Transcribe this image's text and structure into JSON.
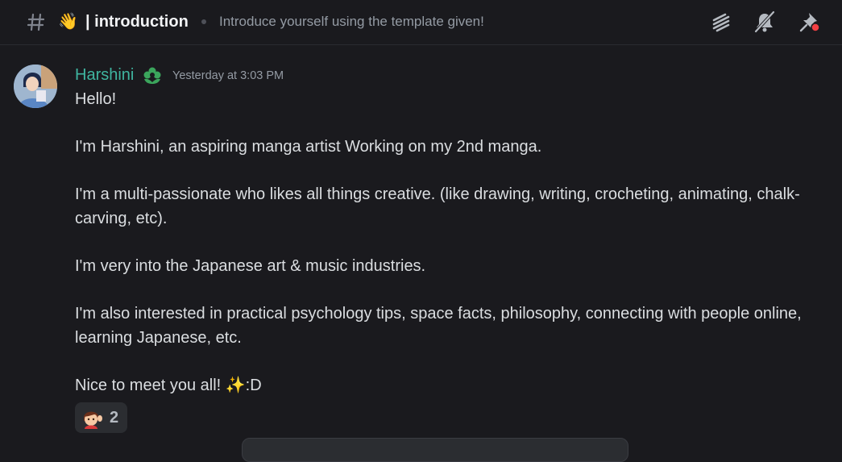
{
  "header": {
    "channel_emoji": "👋",
    "channel_name": "| introduction",
    "topic": "Introduce yourself using the template given!",
    "icons": [
      "threads-icon",
      "notification-muted-icon",
      "pin-icon"
    ]
  },
  "message": {
    "username": "Harshini",
    "username_color": "#3fb5a0",
    "role_icon": "flower-icon",
    "timestamp": "Yesterday at 3:03 PM",
    "lines": [
      "Hello!",
      "I'm Harshini, an aspiring manga artist Working on my 2nd manga.",
      "I'm a multi-passionate who likes all things creative. (like drawing, writing, crocheting, animating, chalk-carving, etc).",
      "I'm very into the Japanese art & music industries.",
      "I'm also interested in practical psychology tips, space facts, philosophy, connecting with people online, learning Japanese, etc.",
      "Nice to meet you all! ✨:D"
    ],
    "reaction": {
      "emoji": "waving-person-emoji",
      "count": "2"
    }
  }
}
